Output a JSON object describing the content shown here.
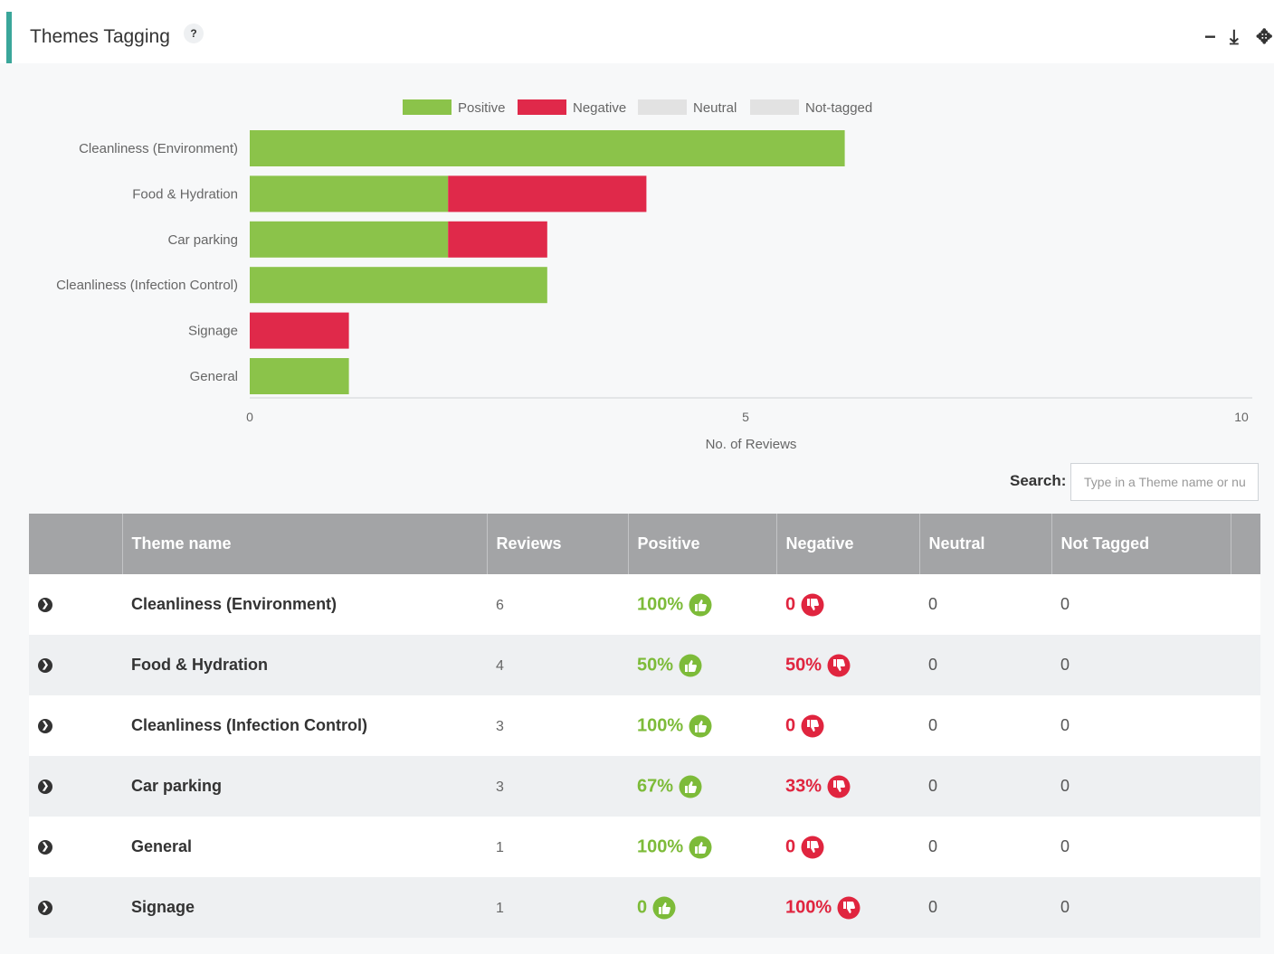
{
  "panel": {
    "title": "Themes Tagging",
    "help_glyph": "?",
    "toolbar": [
      {
        "name": "minimize-icon",
        "glyph": "−"
      },
      {
        "name": "download-icon",
        "glyph": "⤓"
      },
      {
        "name": "move-icon",
        "glyph": "✥"
      }
    ]
  },
  "chart_data": {
    "type": "bar",
    "orientation": "horizontal",
    "stacked": true,
    "categories": [
      "Cleanliness (Environment)",
      "Food & Hydration",
      "Car parking",
      "Cleanliness (Infection Control)",
      "Signage",
      "General"
    ],
    "series": [
      {
        "name": "Positive",
        "color": "#8bc34a",
        "values": [
          6,
          2,
          2,
          3,
          0,
          1
        ]
      },
      {
        "name": "Negative",
        "color": "#e0294a",
        "values": [
          0,
          2,
          1,
          0,
          1,
          0
        ]
      },
      {
        "name": "Neutral",
        "color": "#e2e2e2",
        "values": [
          0,
          0,
          0,
          0,
          0,
          0
        ]
      },
      {
        "name": "Not-tagged",
        "color": "#e2e2e2",
        "values": [
          0,
          0,
          0,
          0,
          0,
          0
        ]
      }
    ],
    "xlabel": "No. of Reviews",
    "ylabel": "",
    "xlim": [
      0,
      10
    ],
    "xticks": [
      0,
      5,
      10
    ],
    "legend_position": "top"
  },
  "search": {
    "label": "Search:",
    "placeholder": "Type in a Theme name or number",
    "value": ""
  },
  "table": {
    "headers": [
      "",
      "Theme name",
      "Reviews",
      "Positive",
      "Negative",
      "Neutral",
      "Not Tagged",
      ""
    ],
    "rows": [
      {
        "theme": "Cleanliness (Environment)",
        "reviews": "6",
        "positive": "100%",
        "negative": "0",
        "neutral": "0",
        "not_tagged": "0"
      },
      {
        "theme": "Food & Hydration",
        "reviews": "4",
        "positive": "50%",
        "negative": "50%",
        "neutral": "0",
        "not_tagged": "0"
      },
      {
        "theme": "Cleanliness (Infection Control)",
        "reviews": "3",
        "positive": "100%",
        "negative": "0",
        "neutral": "0",
        "not_tagged": "0"
      },
      {
        "theme": "Car parking",
        "reviews": "3",
        "positive": "67%",
        "negative": "33%",
        "neutral": "0",
        "not_tagged": "0"
      },
      {
        "theme": "General",
        "reviews": "1",
        "positive": "100%",
        "negative": "0",
        "neutral": "0",
        "not_tagged": "0"
      },
      {
        "theme": "Signage",
        "reviews": "1",
        "positive": "0",
        "negative": "100%",
        "neutral": "0",
        "not_tagged": "0"
      }
    ],
    "colors": {
      "positive": "#7dbb39",
      "negative": "#e0253f"
    }
  }
}
